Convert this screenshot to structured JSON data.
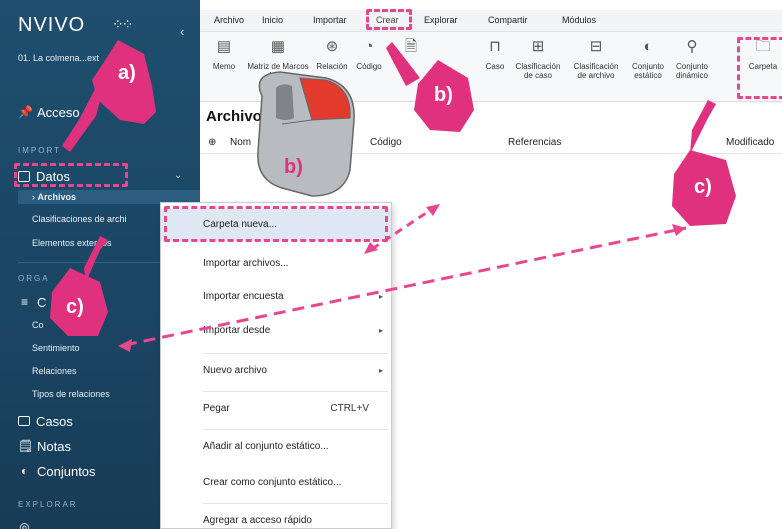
{
  "sidebar": {
    "logo": "NVIVO",
    "project": "01. La colmena...ext",
    "quick_access": "Acceso",
    "section_import": "IMPORT",
    "datos": "Datos",
    "sub_items": [
      "Archivos",
      "Clasificaciones de archi",
      "Elementos externos"
    ],
    "section_organize": "ORGA",
    "codes_partial": "C",
    "code_sub_items": [
      "Co",
      "Sentimiento",
      "Relaciones",
      "Tipos de relaciones"
    ],
    "casos": "Casos",
    "notas": "Notas",
    "conjuntos": "Conjuntos",
    "section_explore": "EXPLORAR"
  },
  "ribbon": {
    "tabs": [
      "Archivo",
      "Inicio",
      "Importar",
      "Crear",
      "Explorar",
      "Compartir",
      "Módulos"
    ],
    "buttons": [
      {
        "label": "Memo",
        "icon": "memo-icon"
      },
      {
        "label": "Matriz de Marcos de tr...",
        "icon": "matrix-icon"
      },
      {
        "label": "Relación",
        "icon": "relation-icon"
      },
      {
        "label": "Código",
        "icon": "code-icon"
      },
      {
        "label": "",
        "icon": "document-icon"
      },
      {
        "label": "Caso",
        "icon": "case-icon"
      },
      {
        "label": "Clasificación de caso",
        "icon": "case-classification-icon"
      },
      {
        "label": "Clasificación de archivo",
        "icon": "file-classification-icon"
      },
      {
        "label": "Conjunto estático",
        "icon": "static-set-icon"
      },
      {
        "label": "Conjunto dinámico",
        "icon": "dynamic-set-icon"
      },
      {
        "label": "Carpeta",
        "icon": "folder-icon"
      }
    ]
  },
  "list": {
    "title": "Archivos",
    "columns": [
      "Nom",
      "Código",
      "Referencias",
      "Modificado"
    ]
  },
  "context_menu": {
    "items": [
      {
        "label": "Carpeta nueva...",
        "submenu": false,
        "shortcut": ""
      },
      {
        "label": "Importar archivos...",
        "submenu": false,
        "shortcut": ""
      },
      {
        "label": "Importar encuesta",
        "submenu": true,
        "shortcut": ""
      },
      {
        "label": "Importar desde",
        "submenu": true,
        "shortcut": ""
      },
      {
        "label": "Nuevo archivo",
        "submenu": true,
        "shortcut": ""
      },
      {
        "label": "Pegar",
        "submenu": false,
        "shortcut": "CTRL+V"
      },
      {
        "label": "Añadir al conjunto estático...",
        "submenu": false,
        "shortcut": ""
      },
      {
        "label": "Crear como conjunto estático...",
        "submenu": false,
        "shortcut": ""
      },
      {
        "label": "Agregar a acceso rápido",
        "submenu": false,
        "shortcut": ""
      }
    ]
  },
  "annotations": {
    "label_a": "a)",
    "label_b": "b)",
    "label_c": "c)",
    "accent_color": "#e8478f"
  }
}
